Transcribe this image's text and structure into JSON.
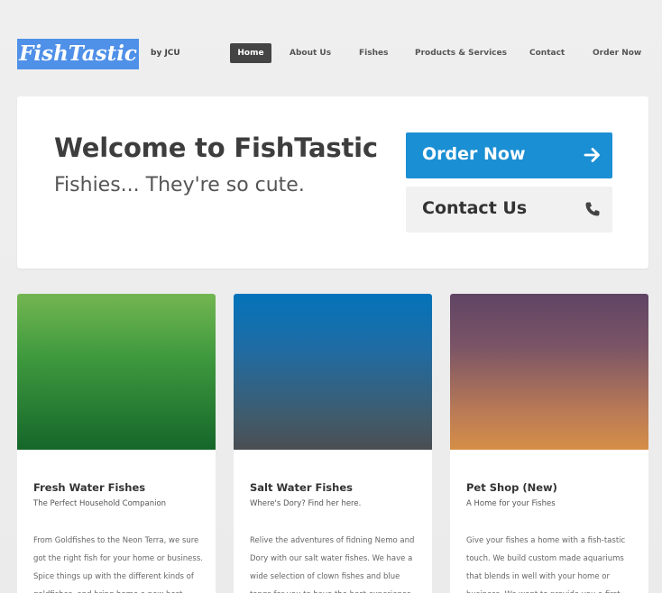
{
  "header": {
    "logo": "FishTastic",
    "byline": "by JCU",
    "nav": [
      {
        "label": "Home",
        "active": true
      },
      {
        "label": "About Us",
        "active": false
      },
      {
        "label": "Fishes",
        "active": false
      },
      {
        "label": "Products & Services",
        "active": false
      },
      {
        "label": "Contact",
        "active": false
      },
      {
        "label": "Order Now",
        "active": false
      }
    ]
  },
  "hero": {
    "title": "Welcome to FishTastic",
    "subtitle": "Fishies... They're so cute.",
    "order_button": "Order Now",
    "contact_button": "Contact Us"
  },
  "cards": [
    {
      "title": "Fresh Water Fishes",
      "subtitle": "The Perfect Household Companion",
      "body": "From Goldfishes to the Neon Terra, we sure got the right fish for your home or business. Spice things up with the different kinds of goldfishes, and bring home a new best friend"
    },
    {
      "title": "Salt Water Fishes",
      "subtitle": "Where's Dory? Find her here.",
      "body": "Relive the adventures of fidning Nemo and Dory with our salt water fishes. We have a wide selection of clown fishes and blue tangs for you to have the best experience of fish"
    },
    {
      "title": "Pet Shop (New)",
      "subtitle": "A Home for your Fishes",
      "body": "Give your fishes a home with a fish-tastic touch. We build custom made aquariums that blends in well with your home or business. We want to provide you a first class"
    }
  ],
  "colors": {
    "brand": "#4f90e8",
    "order_button": "#1b8fd3",
    "nav_active": "#444444"
  },
  "icons": {
    "order": "arrow-right-icon",
    "contact": "phone-icon"
  }
}
